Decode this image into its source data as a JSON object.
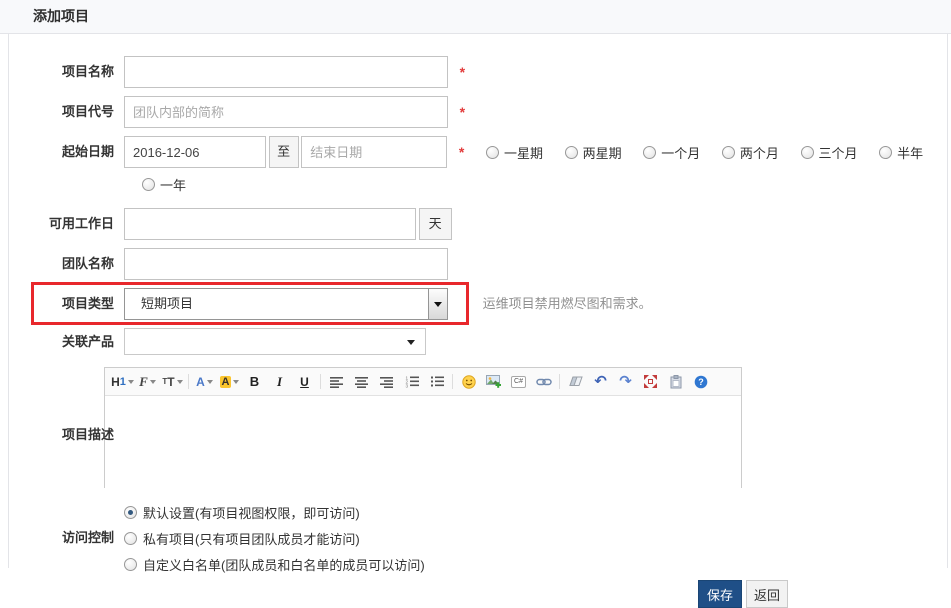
{
  "page": {
    "title": "添加项目"
  },
  "colors": {
    "highlight_box": "#e8272c",
    "required_star": "#e23b3b",
    "primary_button": "#1f4f87",
    "header_bg": "#f8f9fb"
  },
  "form": {
    "required_marker": "*",
    "name_label": "项目名称",
    "code_label": "项目代号",
    "code_placeholder": "团队内部的简称",
    "date_label": "起始日期",
    "date_begin": "2016-12-06",
    "date_to": "至",
    "date_end_placeholder": "结束日期",
    "duration_options": [
      "一星期",
      "两星期",
      "一个月",
      "两个月",
      "三个月",
      "半年",
      "一年"
    ],
    "workdays_label": "可用工作日",
    "workdays_unit": "天",
    "team_label": "团队名称",
    "type_label": "项目类型",
    "type_value": "短期项目",
    "type_hint": "运维项目禁用燃尽图和需求。",
    "products_label": "关联产品",
    "products_value": "",
    "desc_label": "项目描述",
    "acl_label": "访问控制",
    "acl_options": [
      {
        "label": "默认设置(有项目视图权限，即可访问)",
        "selected": true
      },
      {
        "label": "私有项目(只有项目团队成员才能访问)",
        "selected": false
      },
      {
        "label": "自定义白名单(团队成员和白名单的成员可以访问)",
        "selected": false
      }
    ],
    "save_button": "保存",
    "back_button": "返回"
  },
  "editor": {
    "toolbar_icons": [
      "heading",
      "font-family",
      "font-size",
      "text-color",
      "highlight-color",
      "bold",
      "italic",
      "underline",
      "align-left",
      "align-center",
      "align-right",
      "ordered-list",
      "unordered-list",
      "emoji",
      "insert-image",
      "code",
      "link",
      "remove-format",
      "undo",
      "redo",
      "fullscreen",
      "paste",
      "help"
    ],
    "glyphs": {
      "heading_h": "H",
      "heading_level": "1",
      "font_family": "F",
      "size_small": "T",
      "size_large": "T",
      "text_color": "A",
      "highlight": "A",
      "bold": "B",
      "italic": "I",
      "underline": "U",
      "code": "C#",
      "undo": "↶",
      "redo": "↷",
      "help": "?"
    }
  }
}
